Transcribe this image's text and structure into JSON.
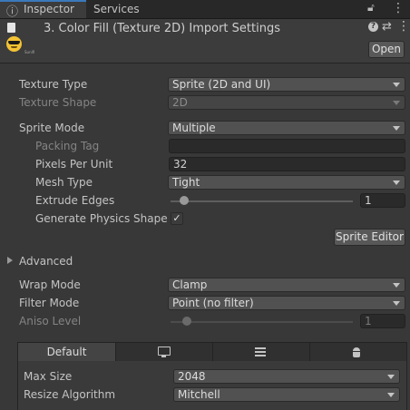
{
  "tabs": {
    "inspector": "Inspector",
    "services": "Services"
  },
  "header": {
    "title": "3. Color Fill (Texture 2D) Import Settings",
    "thumbnail_caption": "Sunifi",
    "open_button": "Open"
  },
  "fields": {
    "texture_type": {
      "label": "Texture Type",
      "value": "Sprite (2D and UI)"
    },
    "texture_shape": {
      "label": "Texture Shape",
      "value": "2D"
    },
    "sprite_mode": {
      "label": "Sprite Mode",
      "value": "Multiple"
    },
    "packing_tag": {
      "label": "Packing Tag",
      "value": ""
    },
    "pixels_per_unit": {
      "label": "Pixels Per Unit",
      "value": "32"
    },
    "mesh_type": {
      "label": "Mesh Type",
      "value": "Tight"
    },
    "extrude_edges": {
      "label": "Extrude Edges",
      "value": "1",
      "fraction": 0.05
    },
    "generate_physics_shape": {
      "label": "Generate Physics Shape",
      "checked": true,
      "check_glyph": "✓"
    },
    "sprite_editor_button": "Sprite Editor",
    "advanced": "Advanced",
    "wrap_mode": {
      "label": "Wrap Mode",
      "value": "Clamp"
    },
    "filter_mode": {
      "label": "Filter Mode",
      "value": "Point (no filter)"
    },
    "aniso_level": {
      "label": "Aniso Level",
      "value": "1",
      "fraction": 0.07
    }
  },
  "platforms": {
    "tabs": [
      {
        "label": "Default",
        "icon": ""
      },
      {
        "label": "",
        "icon": "monitor-icon"
      },
      {
        "label": "",
        "icon": "server-icon"
      },
      {
        "label": "",
        "icon": "android-icon"
      }
    ],
    "max_size": {
      "label": "Max Size",
      "value": "2048"
    },
    "resize_algorithm": {
      "label": "Resize Algorithm",
      "value": "Mitchell"
    }
  },
  "colors": {
    "accent": "#3a79bb",
    "background": "#383838"
  }
}
